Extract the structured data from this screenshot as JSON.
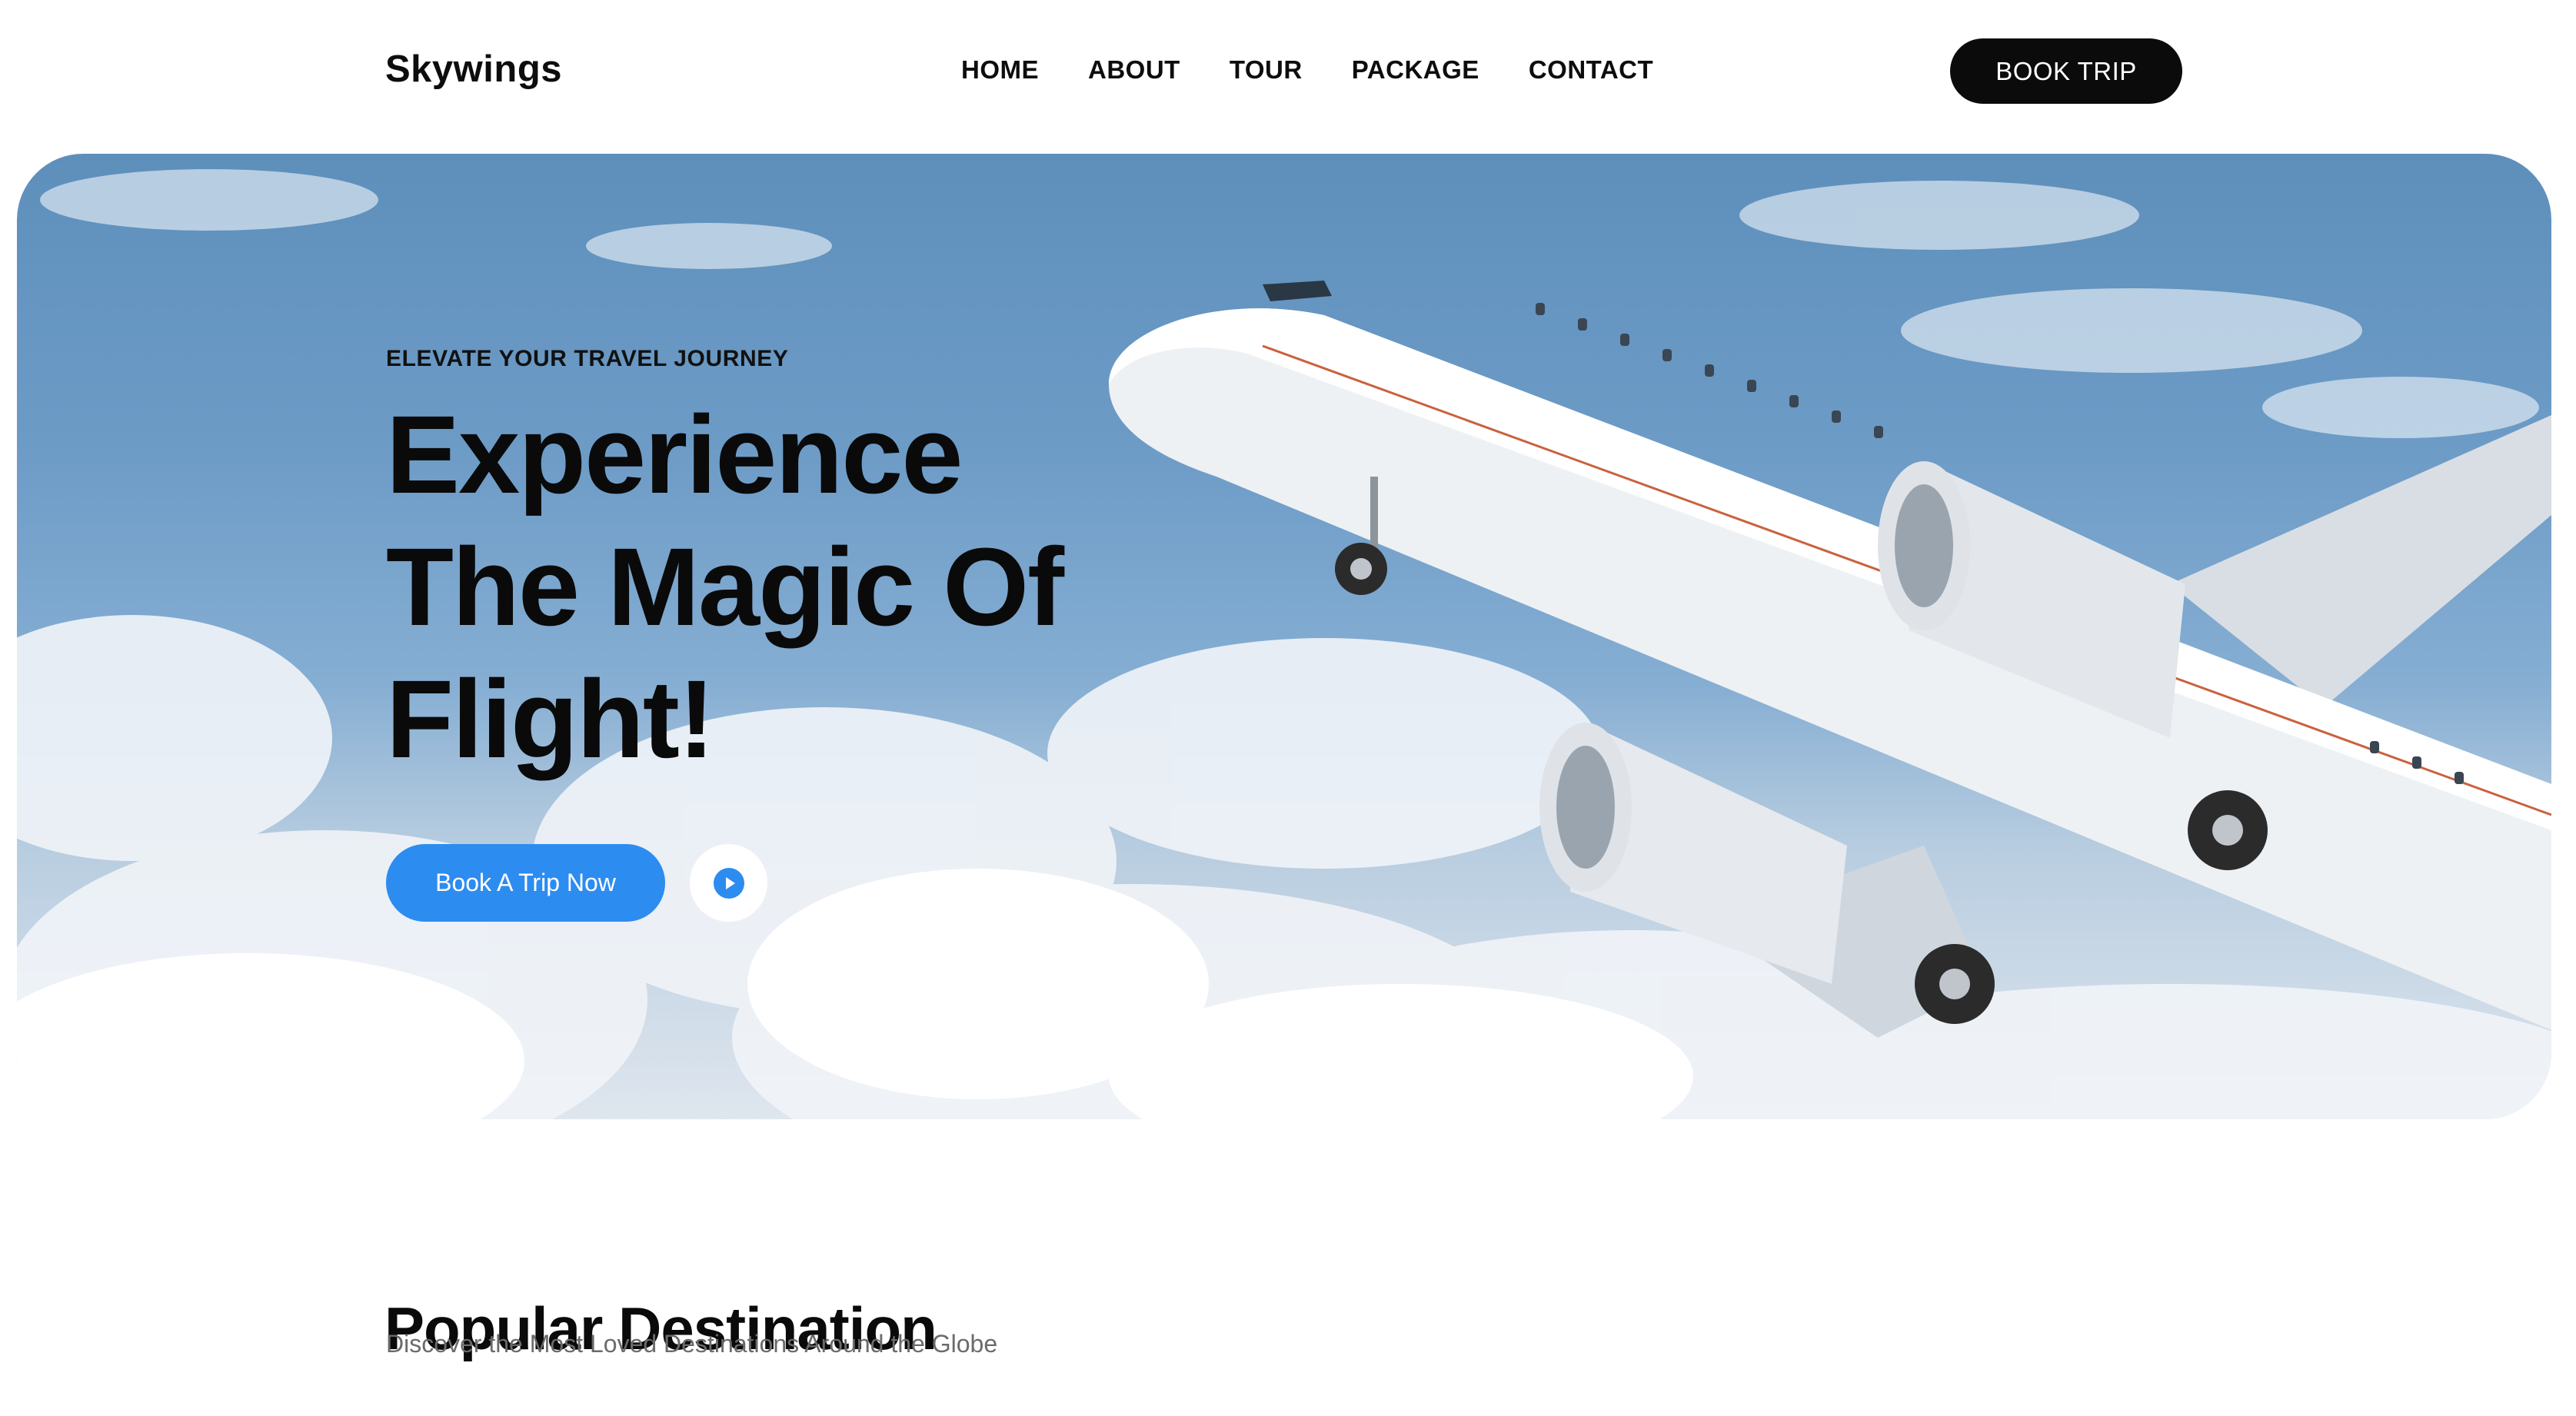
{
  "header": {
    "logo": "Skywings",
    "nav": [
      "HOME",
      "ABOUT",
      "TOUR",
      "PACKAGE",
      "CONTACT"
    ],
    "book_trip_label": "BOOK TRIP"
  },
  "hero": {
    "eyebrow": "ELEVATE YOUR TRAVEL JOURNEY",
    "headline": [
      "Experience",
      "The Magic Of",
      "Flight!"
    ],
    "cta_label": "Book A Trip Now",
    "play_icon": "play-icon",
    "background_image": "airplane-in-cloudy-sky"
  },
  "popular": {
    "title": "Popular Destination",
    "subtitle": "Discover the Most Loved Destinations Around the Globe"
  },
  "colors": {
    "accent": "#2d8cf0",
    "dark_button": "#0b0b0b",
    "text_dark": "#0a0a0a",
    "text_muted": "#6b6b6b",
    "sky": "#6c9bc6"
  }
}
